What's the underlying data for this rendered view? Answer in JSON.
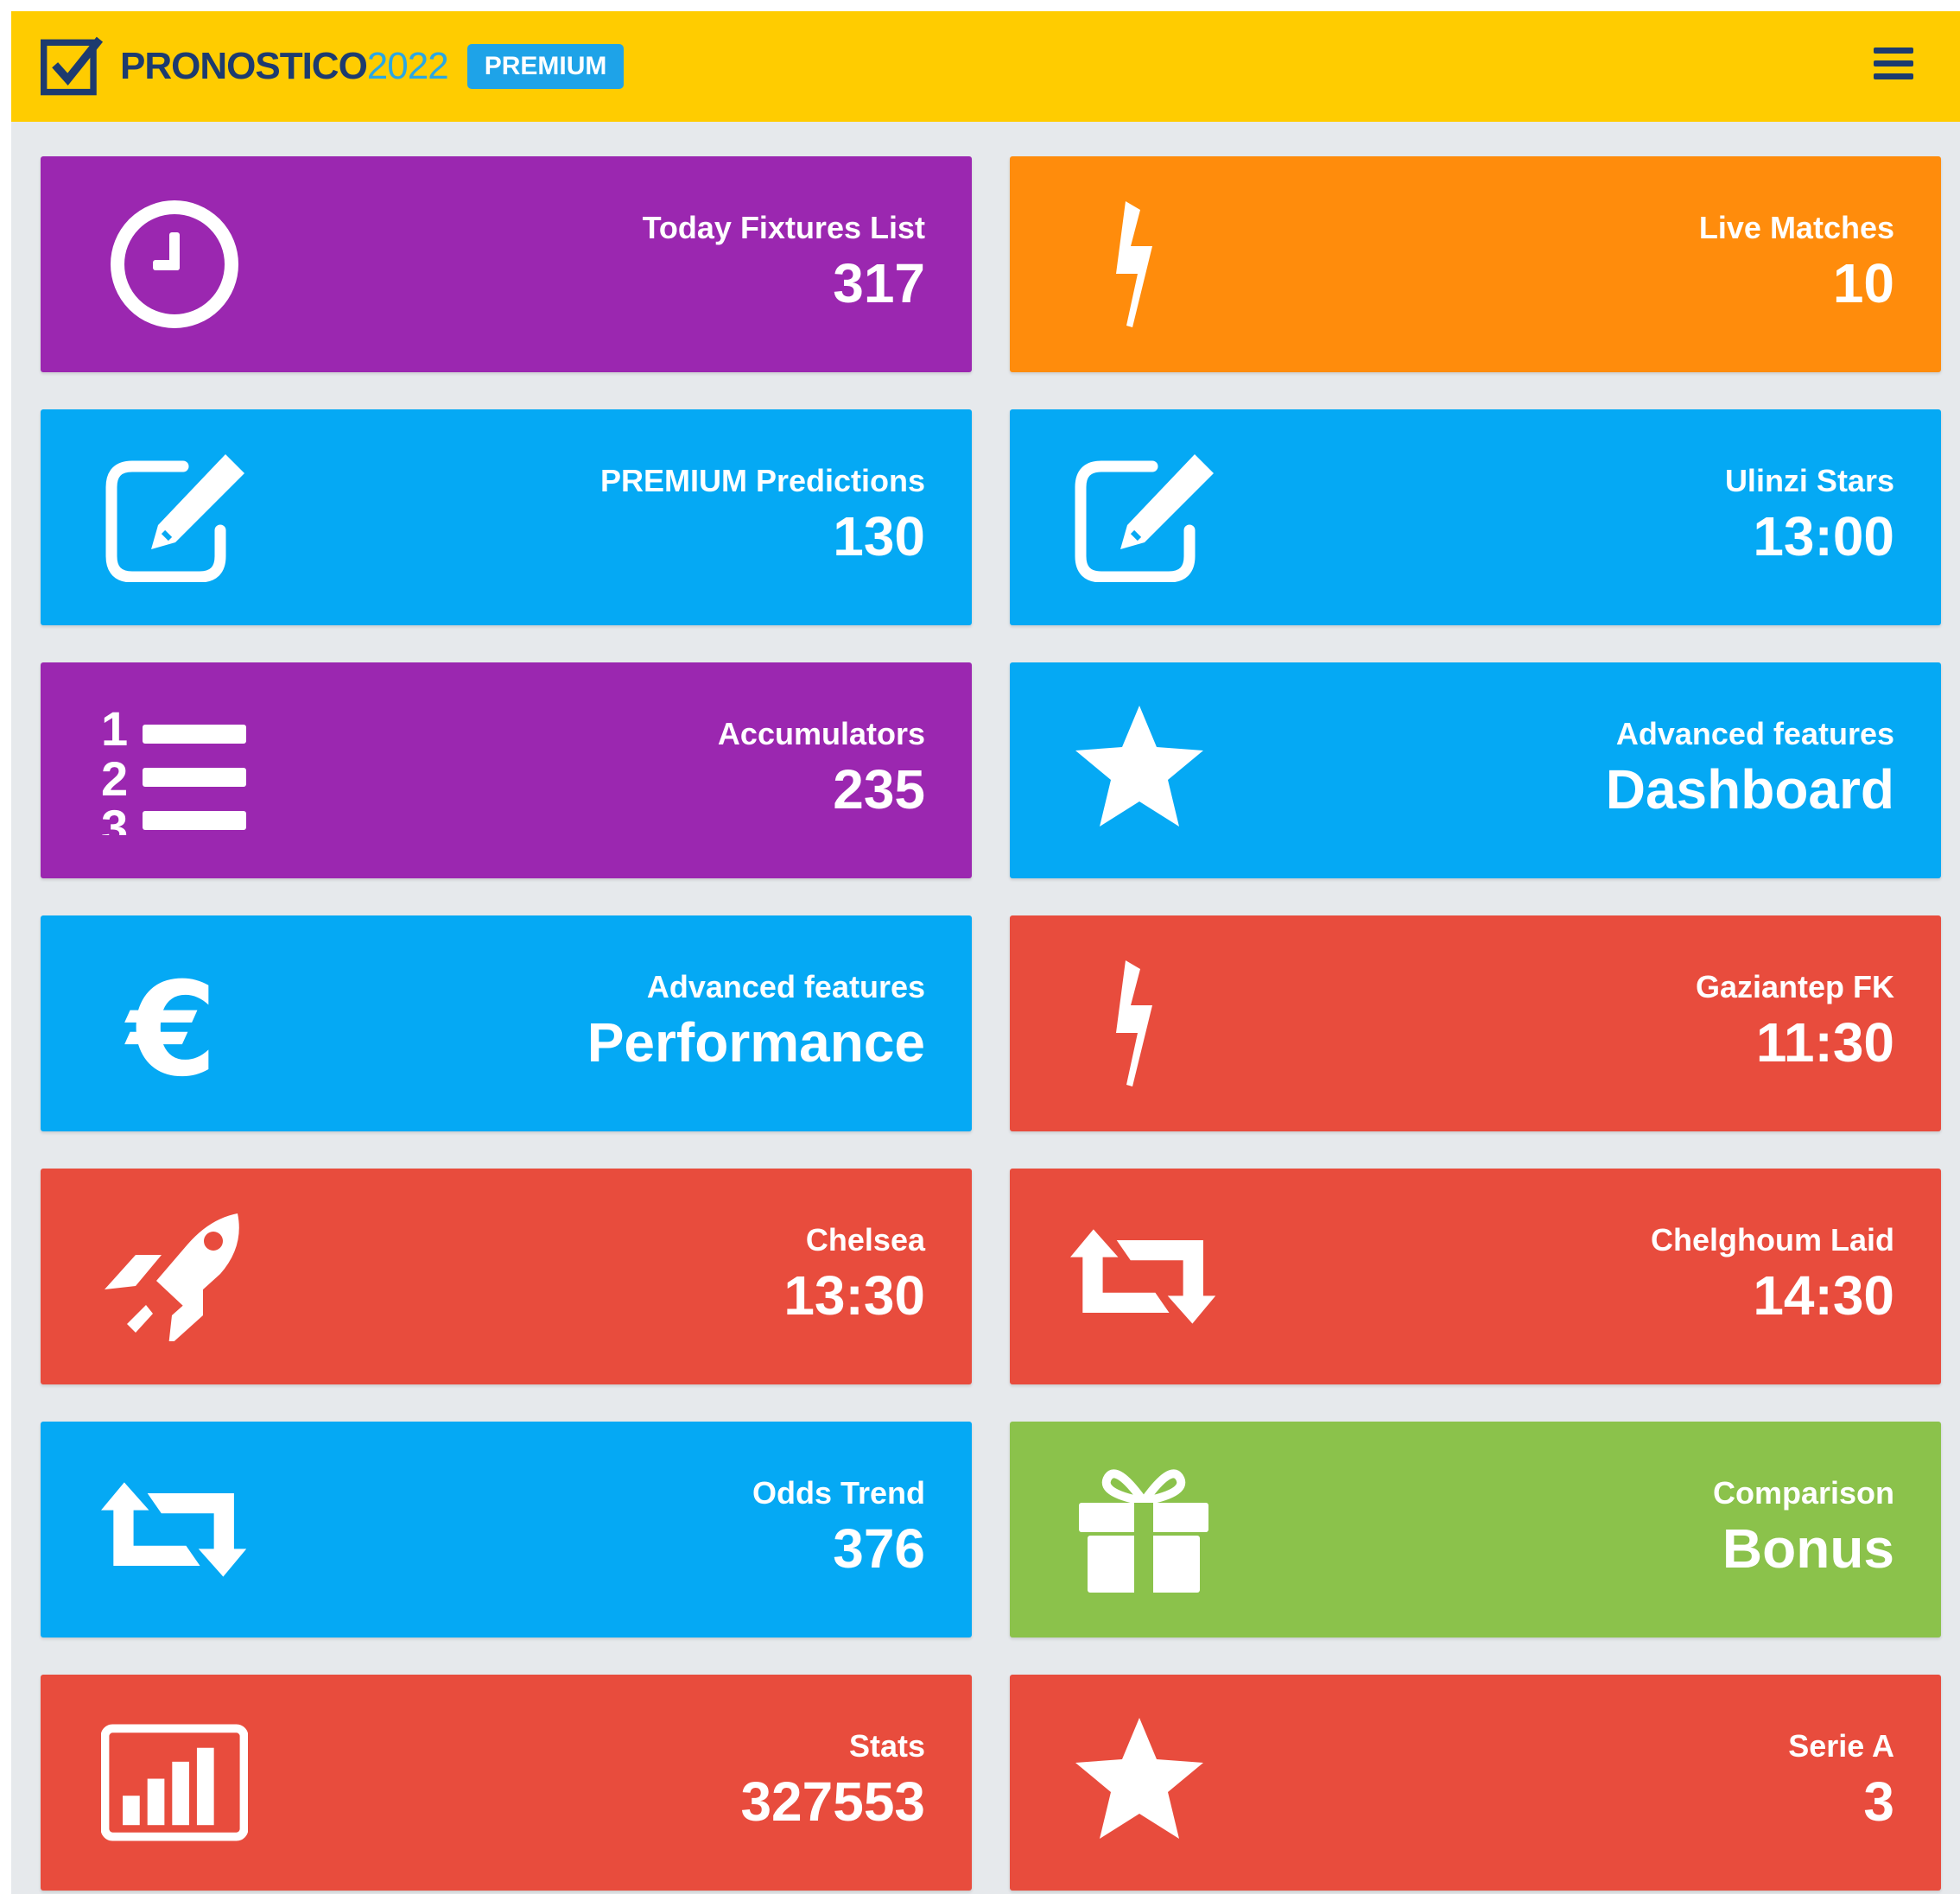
{
  "header": {
    "brand_name": "PRONOSTICO",
    "brand_year": "2022",
    "badge": "PREMIUM"
  },
  "colors": {
    "topbar": "#ffcc00",
    "purple": "#9b27b0",
    "orange": "#ff8c0c",
    "blue": "#05a9f4",
    "red": "#e84c3d",
    "green": "#8bc24b"
  },
  "tiles": [
    {
      "label": "Today Fixtures List",
      "value": "317",
      "icon": "clock-icon",
      "color": "purple"
    },
    {
      "label": "Live Matches",
      "value": "10",
      "icon": "bolt-icon",
      "color": "orange"
    },
    {
      "label": "PREMIUM Predictions",
      "value": "130",
      "icon": "edit-icon",
      "color": "blue"
    },
    {
      "label": "Ulinzi Stars",
      "value": "13:00",
      "icon": "edit-icon",
      "color": "blue"
    },
    {
      "label": "Accumulators",
      "value": "235",
      "icon": "numbered-list-icon",
      "color": "purple"
    },
    {
      "label": "Advanced features",
      "value": "Dashboard",
      "icon": "star-icon",
      "color": "blue"
    },
    {
      "label": "Advanced features",
      "value": "Performance",
      "icon": "euro-icon",
      "color": "blue"
    },
    {
      "label": "Gaziantep FK",
      "value": "11:30",
      "icon": "bolt-icon",
      "color": "red"
    },
    {
      "label": "Chelsea",
      "value": "13:30",
      "icon": "rocket-icon",
      "color": "red"
    },
    {
      "label": "Chelghoum Laid",
      "value": "14:30",
      "icon": "retweet-icon",
      "color": "red"
    },
    {
      "label": "Odds Trend",
      "value": "376",
      "icon": "retweet-icon",
      "color": "blue"
    },
    {
      "label": "Comparison",
      "value": "Bonus",
      "icon": "gift-icon",
      "color": "green"
    },
    {
      "label": "Stats",
      "value": "327553",
      "icon": "bar-chart-icon",
      "color": "red"
    },
    {
      "label": "Serie A",
      "value": "3",
      "icon": "star-icon",
      "color": "red"
    }
  ]
}
